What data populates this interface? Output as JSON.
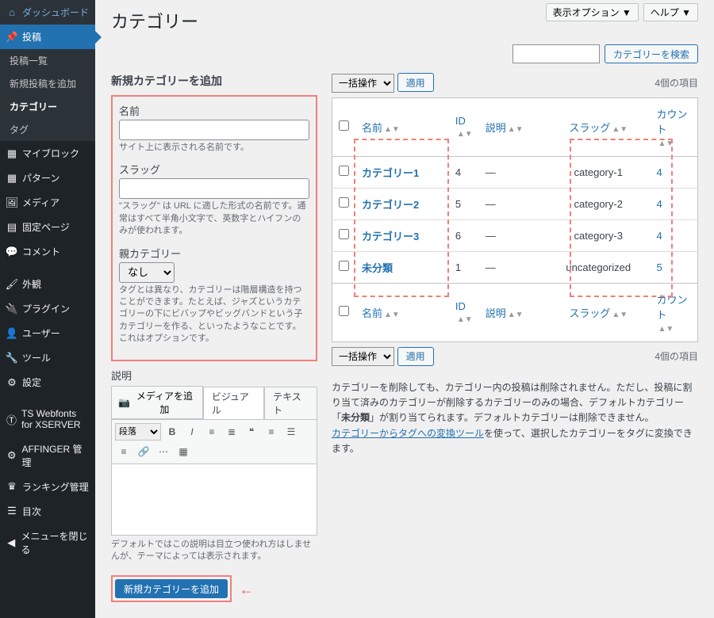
{
  "sidebar": {
    "dashboard": "ダッシュボード",
    "posts": "投稿",
    "posts_sub": [
      "投稿一覧",
      "新規投稿を追加",
      "カテゴリー",
      "タグ"
    ],
    "myblock": "マイブロック",
    "patterns": "パターン",
    "media": "メディア",
    "pages": "固定ページ",
    "comments": "コメント",
    "appearance": "外観",
    "plugins": "プラグイン",
    "users": "ユーザー",
    "tools": "ツール",
    "settings": "設定",
    "ts_webfonts": "TS Webfonts for XSERVER",
    "affinger": "AFFINGER 管理",
    "ranking": "ランキング管理",
    "toc": "目次",
    "collapse": "メニューを閉じる"
  },
  "top": {
    "screen_options": "表示オプション ▼",
    "help": "ヘルプ ▼"
  },
  "page_title": "カテゴリー",
  "search": {
    "button": "カテゴリーを検索"
  },
  "form": {
    "heading": "新規カテゴリーを追加",
    "name_label": "名前",
    "name_help": "サイト上に表示される名前です。",
    "slug_label": "スラッグ",
    "slug_help": "\"スラッグ\" は URL に適した形式の名前です。通常はすべて半角小文字で、英数字とハイフンのみが使われます。",
    "parent_label": "親カテゴリー",
    "parent_option": "なし",
    "parent_help": "タグとは異なり、カテゴリーは階層構造を持つことができます。たとえば、ジャズというカテゴリーの下にビバップやビッグバンドという子カテゴリーを作る、といったようなことです。これはオプションです。",
    "desc_label": "説明",
    "media_btn": "メディアを追加",
    "tab_visual": "ビジュアル",
    "tab_text": "テキスト",
    "format_select": "段落",
    "desc_help": "デフォルトではこの説明は目立つ使われ方はしませんが、テーマによっては表示されます。",
    "submit": "新規カテゴリーを追加"
  },
  "table": {
    "bulk_label": "一括操作",
    "apply": "適用",
    "item_count": "4個の項目",
    "col_name": "名前",
    "col_id": "ID",
    "col_desc": "説明",
    "col_slug": "スラッグ",
    "col_count": "カウント",
    "rows": [
      {
        "name": "カテゴリー1",
        "id": "4",
        "desc": "—",
        "slug": "category-1",
        "count": "4"
      },
      {
        "name": "カテゴリー2",
        "id": "5",
        "desc": "—",
        "slug": "category-2",
        "count": "4"
      },
      {
        "name": "カテゴリー3",
        "id": "6",
        "desc": "—",
        "slug": "category-3",
        "count": "4"
      },
      {
        "name": "未分類",
        "id": "1",
        "desc": "—",
        "slug": "uncategorized",
        "count": "5"
      }
    ]
  },
  "note": {
    "line1a": "カテゴリーを削除しても、カテゴリー内の投稿は削除されません。ただし、投稿に割り当て済みのカテゴリーが削除するカテゴリーのみの場合、デフォルトカテゴリー「",
    "line1b": "未分類",
    "line1c": "」が割り当てられます。デフォルトカテゴリーは削除できません。",
    "link": "カテゴリーからタグへの変換ツール",
    "line2": "を使って、選択したカテゴリーをタグに変換できます。"
  }
}
